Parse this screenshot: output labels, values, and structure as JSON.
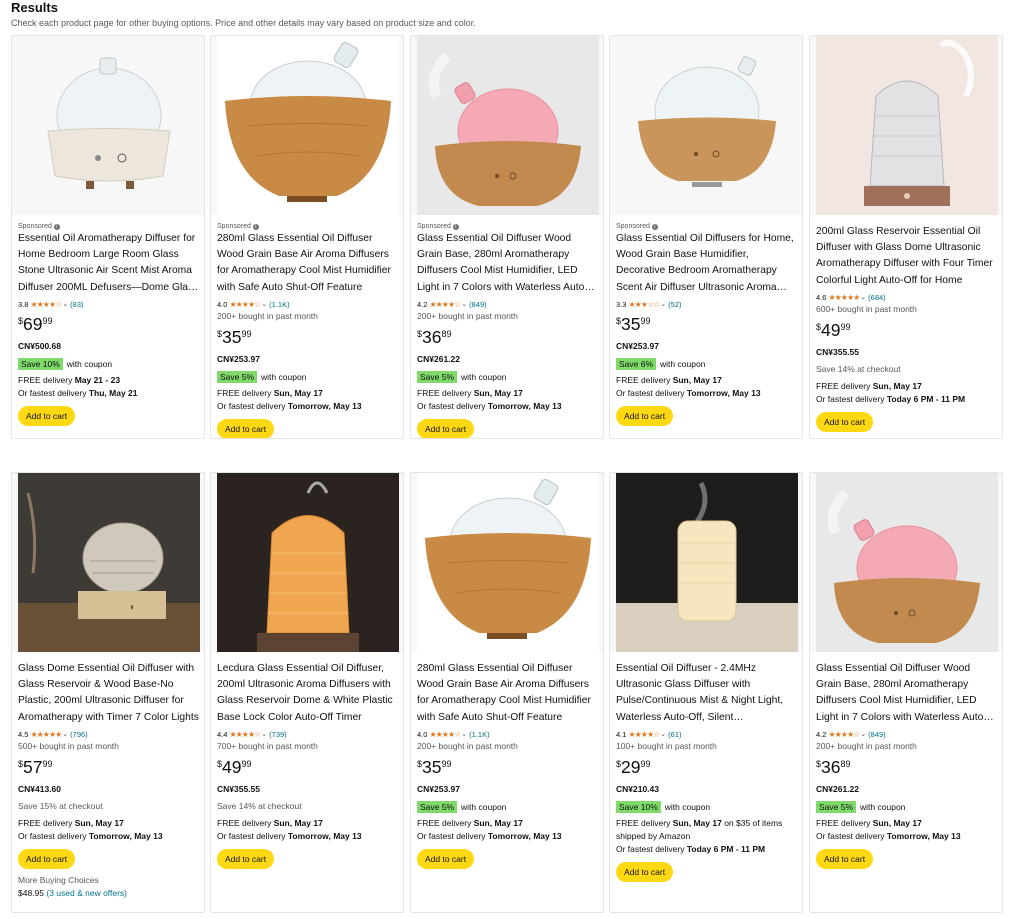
{
  "header": {
    "title": "Results",
    "subtitle": "Check each product page for other buying options. Price and other details may vary based on product size and color."
  },
  "colors": {
    "accent_button": "#ffd814",
    "star": "#de7921",
    "coupon": "#7fda69",
    "link": "#007185"
  },
  "products": [
    {
      "sponsored": "Sponsored",
      "title": "Essential Oil Aromatherapy Diffuser for Home Bedroom Large Room Glass Stone Ultrasonic Air Scent Mist Aroma Diffuser 200ML Defusers—Dome Glass Diffusers",
      "rating": "3.8",
      "stars": "★★★★☆",
      "reviews": "(83)",
      "bought": "",
      "price_sym": "$",
      "price_whole": "69",
      "price_frac": "99",
      "cny": "CN¥500.68",
      "coupon_badge": "Save 10%",
      "coupon_text": "with coupon",
      "checkout": "",
      "delivery_1": "FREE delivery ",
      "delivery_1b": "May 21 - 23",
      "delivery_1c": "",
      "delivery_2": "Or fastest delivery ",
      "delivery_2b": "Thu, May 21",
      "add_to_cart": "Add to cart",
      "image": "stone-diffuser"
    },
    {
      "sponsored": "Sponsored",
      "title": "280ml Glass Essential Oil Diffuser Wood Grain Base Air Aroma Diffusers for Aromatherapy Cool Mist Humidifier with Safe Auto Shut-Off Feature",
      "rating": "4.0",
      "stars": "★★★★☆",
      "reviews": "(1.1K)",
      "bought": "200+ bought in past month",
      "price_sym": "$",
      "price_whole": "35",
      "price_frac": "99",
      "cny": "CN¥253.97",
      "coupon_badge": "Save 5%",
      "coupon_text": "with coupon",
      "checkout": "",
      "delivery_1": "FREE delivery ",
      "delivery_1b": "Sun, May 17",
      "delivery_1c": "",
      "delivery_2": "Or fastest delivery ",
      "delivery_2b": "Tomorrow, May 13",
      "add_to_cart": "Add to cart",
      "image": "wood-dome"
    },
    {
      "sponsored": "Sponsored",
      "title": "Glass Essential Oil Diffuser Wood Grain Base, 280ml Aromatherapy Diffusers Cool Mist Humidifier, LED Light in 7 Colors with Waterless Auto-Off",
      "rating": "4.2",
      "stars": "★★★★☆",
      "reviews": "(849)",
      "bought": "200+ bought in past month",
      "price_sym": "$",
      "price_whole": "36",
      "price_frac": "89",
      "cny": "CN¥261.22",
      "coupon_badge": "Save 5%",
      "coupon_text": "with coupon",
      "checkout": "",
      "delivery_1": "FREE delivery ",
      "delivery_1b": "Sun, May 17",
      "delivery_1c": "",
      "delivery_2": "Or fastest delivery ",
      "delivery_2b": "Tomorrow, May 13",
      "add_to_cart": "Add to cart",
      "image": "pink-dome"
    },
    {
      "sponsored": "Sponsored",
      "title": "Glass Essential Oil Diffusers for Home, Wood Grain Base Humidifier, Decorative Bedroom Aromatherapy Scent Air Diffuser Ultrasonic Aroma Diffuser",
      "rating": "3.3",
      "stars": "★★★☆☆",
      "reviews": "(52)",
      "bought": "",
      "price_sym": "$",
      "price_whole": "35",
      "price_frac": "99",
      "cny": "CN¥253.97",
      "coupon_badge": "Save 6%",
      "coupon_text": "with coupon",
      "checkout": "",
      "delivery_1": "FREE delivery ",
      "delivery_1b": "Sun, May 17",
      "delivery_1c": "",
      "delivery_2": "Or fastest delivery ",
      "delivery_2b": "Tomorrow, May 13",
      "add_to_cart": "Add to cart",
      "image": "wood-small"
    },
    {
      "sponsored": "",
      "title": "200ml Glass Reservoir Essential Oil Diffuser with Glass Dome Ultrasonic Aromatherapy Diffuser with Four Timer Colorful Light Auto-Off for Home",
      "rating": "4.6",
      "stars": "★★★★★",
      "reviews": "(684)",
      "bought": "600+ bought in past month",
      "price_sym": "$",
      "price_whole": "49",
      "price_frac": "99",
      "cny": "CN¥355.55",
      "coupon_badge": "",
      "coupon_text": "",
      "checkout": "Save 14% at checkout",
      "delivery_1": "FREE delivery ",
      "delivery_1b": "Sun, May 17",
      "delivery_1c": "",
      "delivery_2": "Or fastest delivery ",
      "delivery_2b": "Today 6 PM - 11 PM",
      "add_to_cart": "Add to cart",
      "image": "crystal-copper"
    },
    {
      "sponsored": "",
      "title": "Glass Dome Essential Oil Diffuser with Glass Reservoir & Wood Base-No Plastic, 200ml Ultrasonic Diffuser for Aromatherapy with Timer 7 Color Lights",
      "rating": "4.5",
      "stars": "★★★★★",
      "reviews": "(796)",
      "bought": "500+ bought in past month",
      "price_sym": "$",
      "price_whole": "57",
      "price_frac": "99",
      "cny": "CN¥413.60",
      "coupon_badge": "",
      "coupon_text": "",
      "checkout": "Save 15% at checkout",
      "delivery_1": "FREE delivery ",
      "delivery_1b": "Sun, May 17",
      "delivery_1c": "",
      "delivery_2": "Or fastest delivery ",
      "delivery_2b": "Tomorrow, May 13",
      "add_to_cart": "Add to cart",
      "more_label": "More Buying Choices",
      "more_price": "$48.95",
      "more_link": "(3 used & new offers)",
      "image": "dome-wood-dark"
    },
    {
      "sponsored": "",
      "title": "Lecdura Glass Essential Oil Diffuser, 200ml Ultrasonic Aroma Diffusers with Glass Reservoir Dome & White Plastic Base Lock Color Auto-Off Timer",
      "rating": "4.4",
      "stars": "★★★★☆",
      "reviews": "(739)",
      "bought": "700+ bought in past month",
      "price_sym": "$",
      "price_whole": "49",
      "price_frac": "99",
      "cny": "CN¥355.55",
      "coupon_badge": "",
      "coupon_text": "",
      "checkout": "Save 14% at checkout",
      "delivery_1": "FREE delivery ",
      "delivery_1b": "Sun, May 17",
      "delivery_1c": "",
      "delivery_2": "Or fastest delivery ",
      "delivery_2b": "Tomorrow, May 13",
      "add_to_cart": "Add to cart",
      "image": "amber-crystal"
    },
    {
      "sponsored": "",
      "title": "280ml Glass Essential Oil Diffuser Wood Grain Base Air Aroma Diffusers for Aromatherapy Cool Mist Humidifier with Safe Auto Shut-Off Feature",
      "rating": "4.0",
      "stars": "★★★★☆",
      "reviews": "(1.1K)",
      "bought": "200+ bought in past month",
      "price_sym": "$",
      "price_whole": "35",
      "price_frac": "99",
      "cny": "CN¥253.97",
      "coupon_badge": "Save 5%",
      "coupon_text": "with coupon",
      "checkout": "",
      "delivery_1": "FREE delivery ",
      "delivery_1b": "Sun, May 17",
      "delivery_1c": "",
      "delivery_2": "Or fastest delivery ",
      "delivery_2b": "Tomorrow, May 13",
      "add_to_cart": "Add to cart",
      "image": "wood-dome"
    },
    {
      "sponsored": "",
      "title": "Essential Oil Diffuser - 2.4MHz Ultrasonic Glass Diffuser with Pulse/Continuous Mist & Night Light, Waterless Auto-Off, Silent Aromatherapy Diffuser",
      "rating": "4.1",
      "stars": "★★★★☆",
      "reviews": "(61)",
      "bought": "100+ bought in past month",
      "price_sym": "$",
      "price_whole": "29",
      "price_frac": "99",
      "cny": "CN¥210.43",
      "coupon_badge": "Save 10%",
      "coupon_text": "with coupon",
      "checkout": "",
      "delivery_1": "FREE delivery ",
      "delivery_1b": "Sun, May 17",
      "delivery_1c": " on $35 of items shipped by Amazon",
      "delivery_2": "Or fastest delivery ",
      "delivery_2b": "Today 6 PM - 11 PM",
      "add_to_cart": "Add to cart",
      "image": "cylinder-glow"
    },
    {
      "sponsored": "",
      "title": "Glass Essential Oil Diffuser Wood Grain Base, 280ml Aromatherapy Diffusers Cool Mist Humidifier, LED Light in 7 Colors with Waterless Auto-Off",
      "rating": "4.2",
      "stars": "★★★★☆",
      "reviews": "(849)",
      "bought": "200+ bought in past month",
      "price_sym": "$",
      "price_whole": "36",
      "price_frac": "89",
      "cny": "CN¥261.22",
      "coupon_badge": "Save 5%",
      "coupon_text": "with coupon",
      "checkout": "",
      "delivery_1": "FREE delivery ",
      "delivery_1b": "Sun, May 17",
      "delivery_1c": "",
      "delivery_2": "Or fastest delivery ",
      "delivery_2b": "Tomorrow, May 13",
      "add_to_cart": "Add to cart",
      "image": "pink-dome"
    }
  ]
}
